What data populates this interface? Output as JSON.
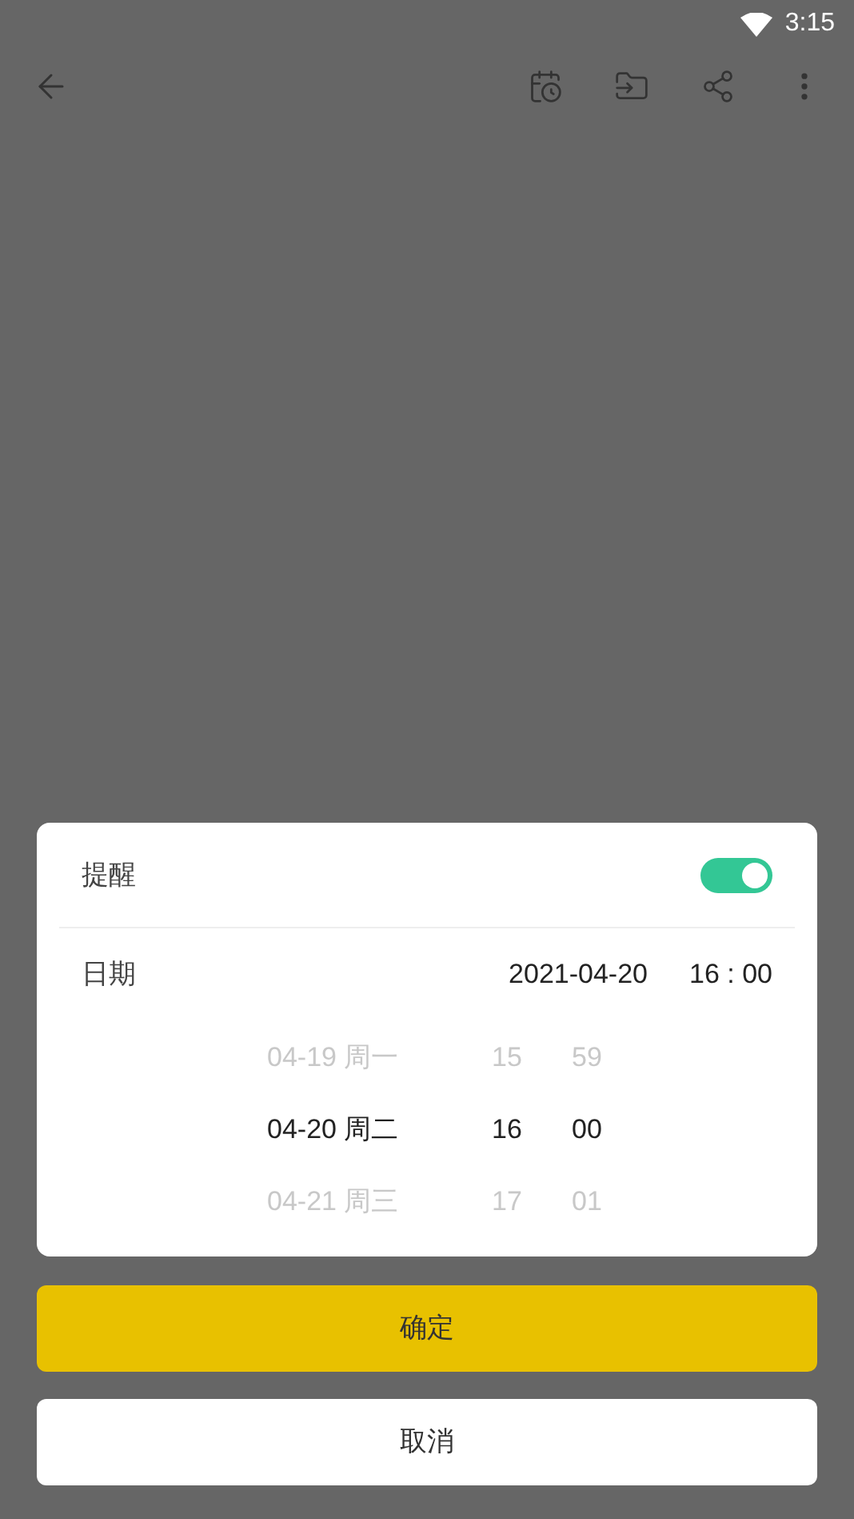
{
  "status_bar": {
    "time": "3:15"
  },
  "reminder": {
    "label": "提醒",
    "on": true
  },
  "date": {
    "label": "日期",
    "date_value": "2021-04-20",
    "time_value": "16 : 00"
  },
  "picker": {
    "rows": [
      {
        "date": "04-19 周一",
        "hour": "15",
        "minute": "59",
        "selected": false
      },
      {
        "date": "04-20 周二",
        "hour": "16",
        "minute": "00",
        "selected": true
      },
      {
        "date": "04-21 周三",
        "hour": "17",
        "minute": "01",
        "selected": false
      }
    ]
  },
  "buttons": [
    {
      "label": "确定",
      "kind": "primary"
    },
    {
      "label": "取消",
      "kind": "secondary"
    }
  ]
}
